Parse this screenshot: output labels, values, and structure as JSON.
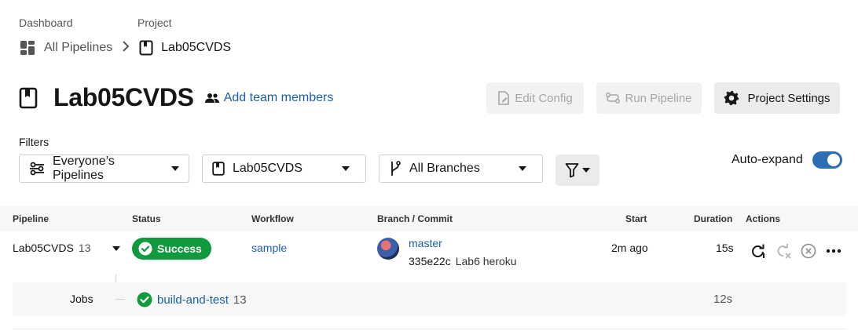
{
  "breadcrumb": {
    "dashboard_label": "Dashboard",
    "dashboard_link": "All Pipelines",
    "project_label": "Project",
    "project_name": "Lab05CVDS"
  },
  "header": {
    "title": "Lab05CVDS",
    "add_team_members": "Add team members",
    "buttons": {
      "edit_config": "Edit Config",
      "run_pipeline": "Run Pipeline",
      "project_settings": "Project Settings"
    }
  },
  "filters": {
    "label": "Filters",
    "pipelines_select": "Everyone’s Pipelines",
    "project_select": "Lab05CVDS",
    "branch_select": "All Branches",
    "auto_expand_label": "Auto-expand",
    "auto_expand_on": true
  },
  "table": {
    "headers": {
      "pipeline": "Pipeline",
      "status": "Status",
      "workflow": "Workflow",
      "branch_commit": "Branch / Commit",
      "start": "Start",
      "duration": "Duration",
      "actions": "Actions"
    },
    "row": {
      "pipeline_name": "Lab05CVDS",
      "pipeline_number": "13",
      "status": "Success",
      "workflow": "sample",
      "branch": "master",
      "commit_hash": "335e22c",
      "commit_message": "Lab6 heroku",
      "start": "2m ago",
      "duration": "15s"
    },
    "jobs": {
      "label": "Jobs",
      "job_name": "build-and-test",
      "job_number": "13",
      "duration": "12s"
    }
  },
  "colors": {
    "success": "#0e9a3d",
    "link": "#1d5ea8",
    "toggle": "#2c6db3"
  }
}
